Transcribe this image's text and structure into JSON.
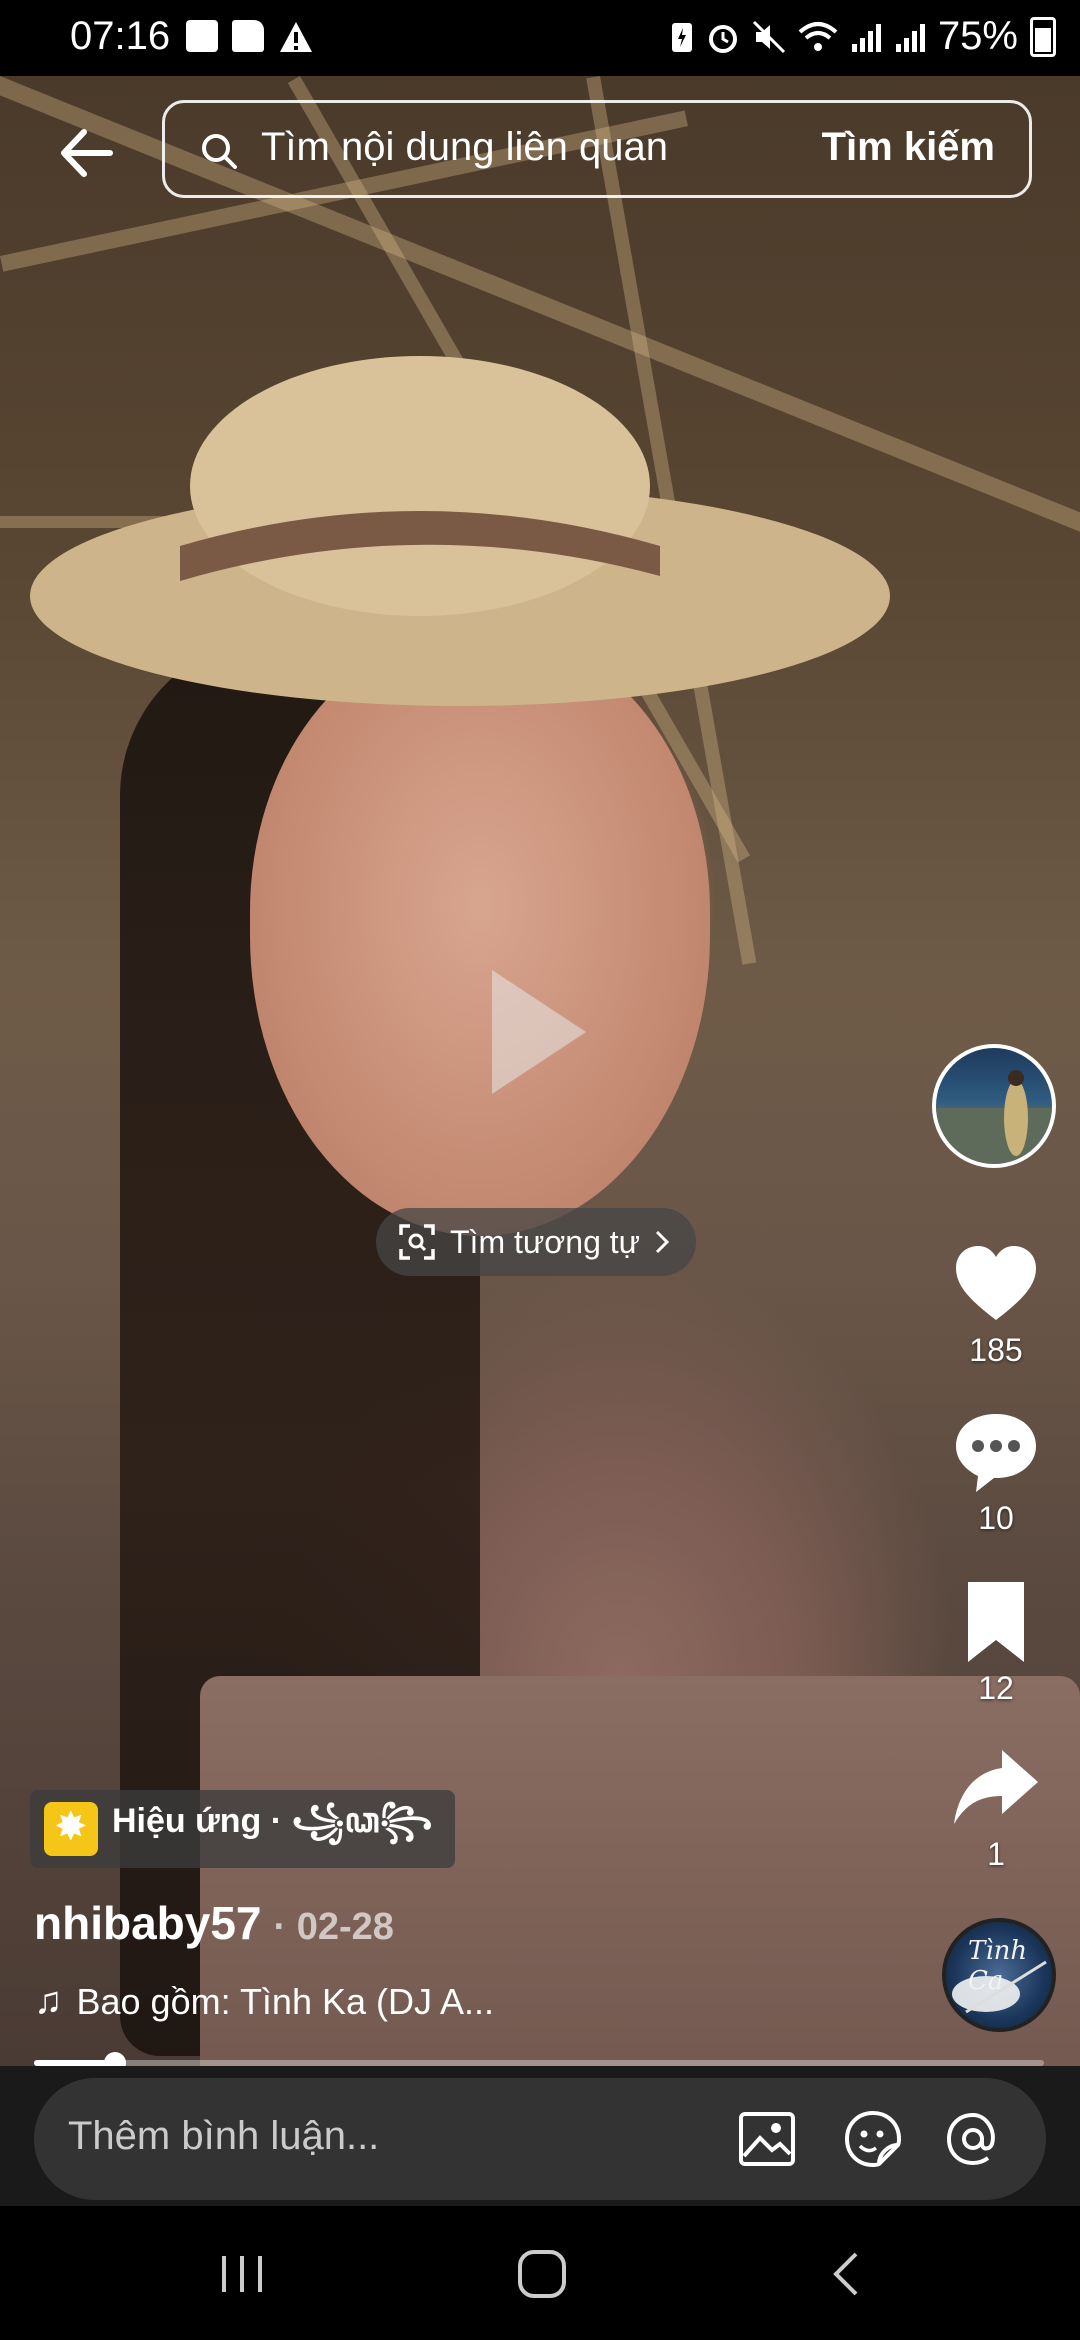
{
  "status_bar": {
    "time": "07:16",
    "battery": "75%",
    "left_icons": [
      "checkbox-icon",
      "folder-icon",
      "warning-icon"
    ],
    "right_icons": [
      "battery-saver-icon",
      "alarm-icon",
      "mute-icon",
      "wifi-icon",
      "signal-icon",
      "signal-icon",
      "battery-icon"
    ]
  },
  "search": {
    "placeholder": "Tìm nội dung liên quan",
    "submit_label": "Tìm kiếm"
  },
  "video": {
    "find_similar_label": "Tìm tương tự",
    "progress": 0.08
  },
  "actions": {
    "likes": "185",
    "comments": "10",
    "saves": "12",
    "shares": "1"
  },
  "music_disc": {
    "label": "Tình Ca"
  },
  "post": {
    "effect_label": "Hiệu ứng · ꧁ꦣ꧂",
    "author": "nhibaby57",
    "date": "· 02-28",
    "music": "Bao gồm: Tình Ka (DJ A..."
  },
  "comment": {
    "placeholder": "Thêm bình luận..."
  },
  "colors": {
    "effect_icon": "#f5c518",
    "comment_bg": "#333333"
  }
}
